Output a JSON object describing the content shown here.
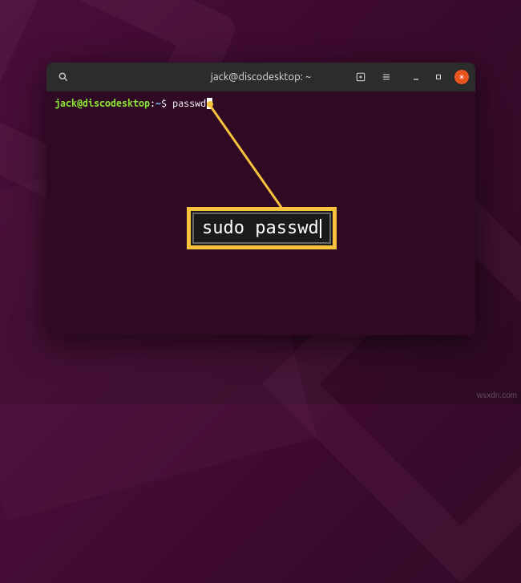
{
  "terminal": {
    "title": "jack@discodesktop: ~",
    "prompt": {
      "user_host": "jack@discodesktop",
      "separator": ":",
      "path": "~",
      "symbol": "$"
    },
    "command": "passwd"
  },
  "callout": {
    "text": "sudo passwd"
  },
  "watermark": "wsxdn.com"
}
